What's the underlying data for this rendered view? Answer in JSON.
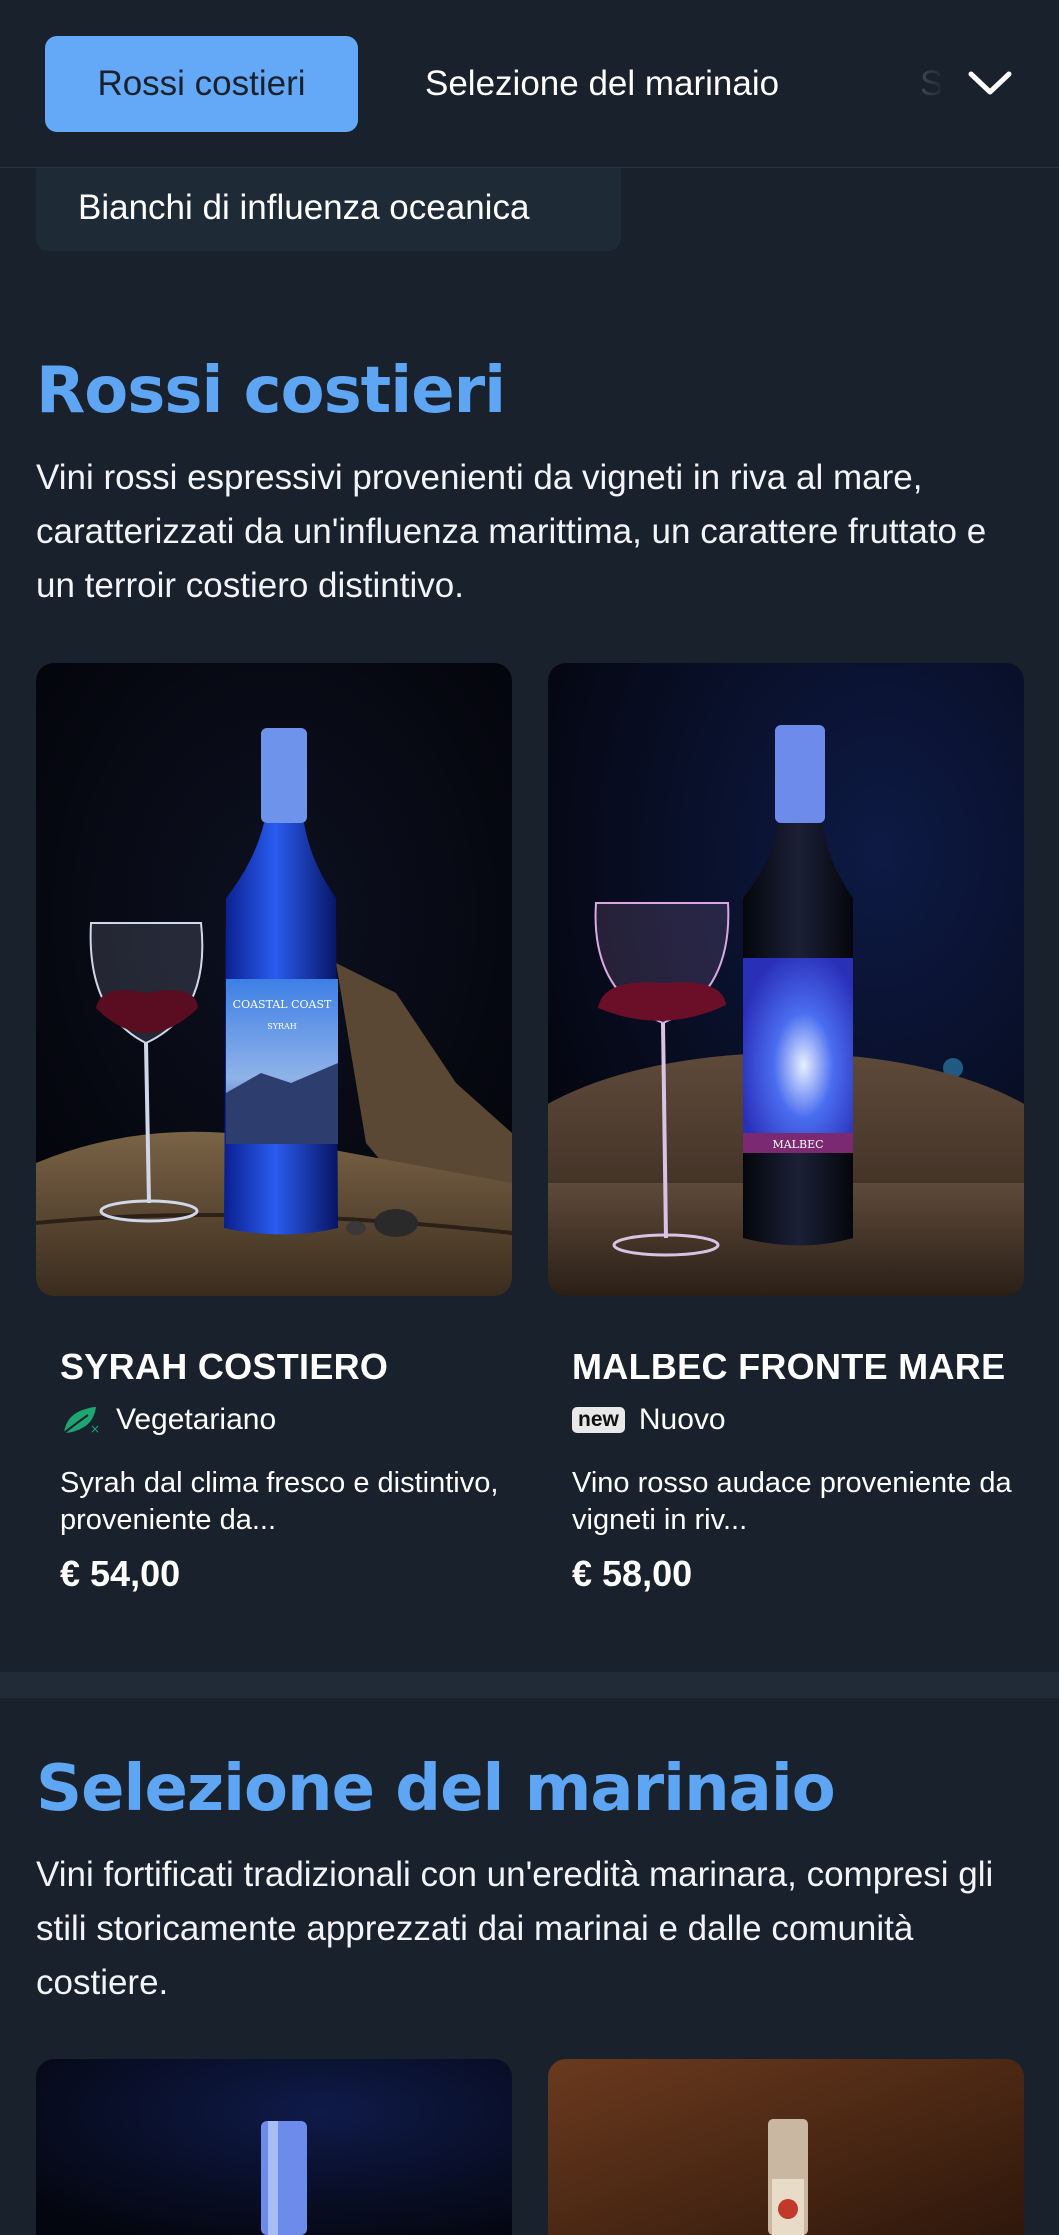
{
  "tabs": {
    "active": "Rossi costieri",
    "second": "Selezione del marinaio",
    "third_partial": "S",
    "overflow": "Bianchi di influenza oceanica"
  },
  "sections": [
    {
      "title": "Rossi costieri",
      "description": "Vini rossi espressivi provenienti da vigneti in riva al mare, caratterizzati da un'influenza marittima, un carattere fruttato e un terroir costiero distintivo.",
      "products": [
        {
          "name": "SYRAH COSTIERO",
          "badge": "Vegetariano",
          "badge_icon": "vegetarian-leaf-icon",
          "description": "Syrah dal clima fresco e distintivo, proveniente da...",
          "price": "€ 54,00",
          "label_line1": "COASTAL COAST",
          "label_line2": "SYRAH"
        },
        {
          "name": "MALBEC FRONTE MARE",
          "badge": "Nuovo",
          "badge_icon": "new-pill-icon",
          "badge_pill": "new",
          "description": "Vino rosso audace proveniente da vigneti in riv...",
          "price": "€ 58,00",
          "label_line1": "MALBEC"
        }
      ]
    },
    {
      "title": "Selezione del marinaio",
      "description": "Vini fortificati tradizionali con un'eredità marinara, compresi gli stili storicamente apprezzati dai marinai e dalle comunità costiere."
    }
  ],
  "colors": {
    "background": "#19212c",
    "accent": "#5ea5f4",
    "active_tab": "#63a9f7"
  }
}
